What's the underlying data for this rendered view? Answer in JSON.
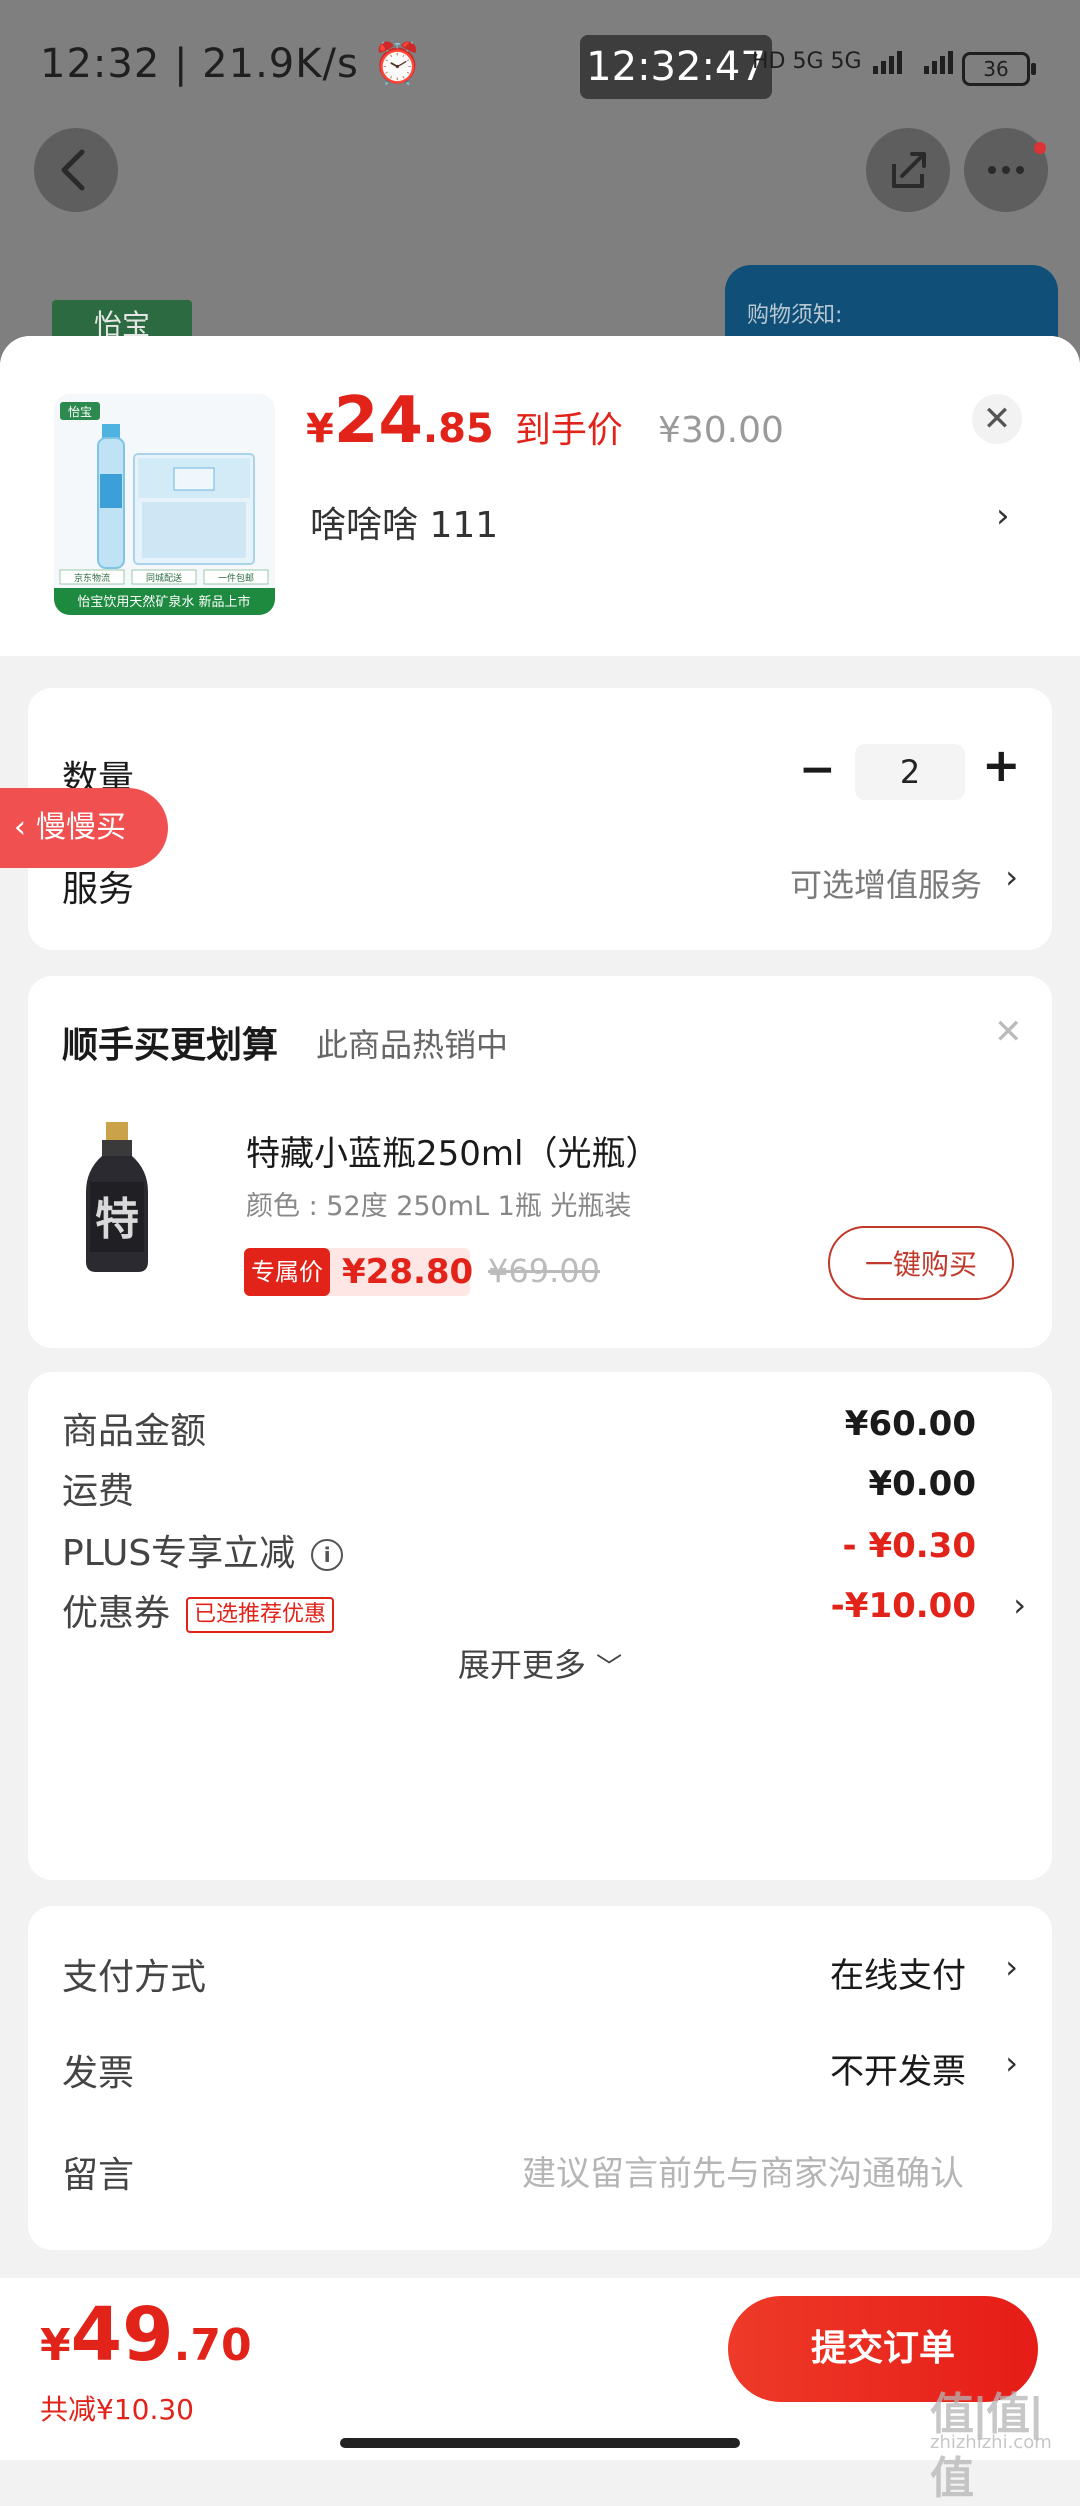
{
  "status_bar": {
    "left": "12:32 | 21.9K/s ⏰",
    "clock": "12:32:47",
    "network": "HD 5G 5G",
    "battery": "36"
  },
  "background": {
    "logo_text": "怡宝",
    "notice_title": "购物须知:"
  },
  "product": {
    "price_symbol": "¥",
    "price_int": "24",
    "price_dec": ".85",
    "price_tag": "到手价",
    "orig_price": "¥30.00",
    "variant": "啥啥啥  111",
    "thumb_brand": "怡宝",
    "thumb_caption": "怡宝饮用天然矿泉水 新品上市",
    "thumb_tags": [
      "京东物流",
      "同城配送",
      "一件包邮"
    ]
  },
  "quantity": {
    "label": "数量",
    "value": "2",
    "minus": "−",
    "plus": "+"
  },
  "service": {
    "label": "服务",
    "value": "可选增值服务"
  },
  "slow_buy": {
    "label": "慢慢买"
  },
  "addon": {
    "title": "顺手买更划算",
    "subtitle": "此商品热销中",
    "name": "特藏小蓝瓶250ml（光瓶）",
    "spec": "颜色 : 52度 250mL 1瓶 光瓶装",
    "badge": "专属价",
    "price": "¥28.80",
    "orig_price": "¥69.00",
    "buy_label": "一键购买",
    "bottle_char": "特"
  },
  "summary": {
    "rows": [
      {
        "label": "商品金额",
        "value": "¥60.00"
      },
      {
        "label": "运费",
        "value": "¥0.00"
      },
      {
        "label": "PLUS专享立减",
        "value": "- ¥0.30"
      },
      {
        "label": "优惠券",
        "tag": "已选推荐优惠",
        "value": "-¥10.00"
      }
    ],
    "expand": "展开更多"
  },
  "payment": {
    "method_label": "支付方式",
    "method_value": "在线支付",
    "invoice_label": "发票",
    "invoice_value": "不开发票",
    "remark_label": "留言",
    "remark_placeholder": "建议留言前先与商家沟通确认"
  },
  "footer": {
    "total_symbol": "¥",
    "total_int": "49",
    "total_dec": ".70",
    "saved": "共减¥10.30",
    "submit": "提交订单",
    "watermark": "值|值|值",
    "watermark_sub": "zhizhizhi.com"
  },
  "colors": {
    "accent": "#e2231a",
    "dim_bg": "#7f7f7f",
    "card": "#ffffff",
    "page": "#f2f2f2"
  }
}
